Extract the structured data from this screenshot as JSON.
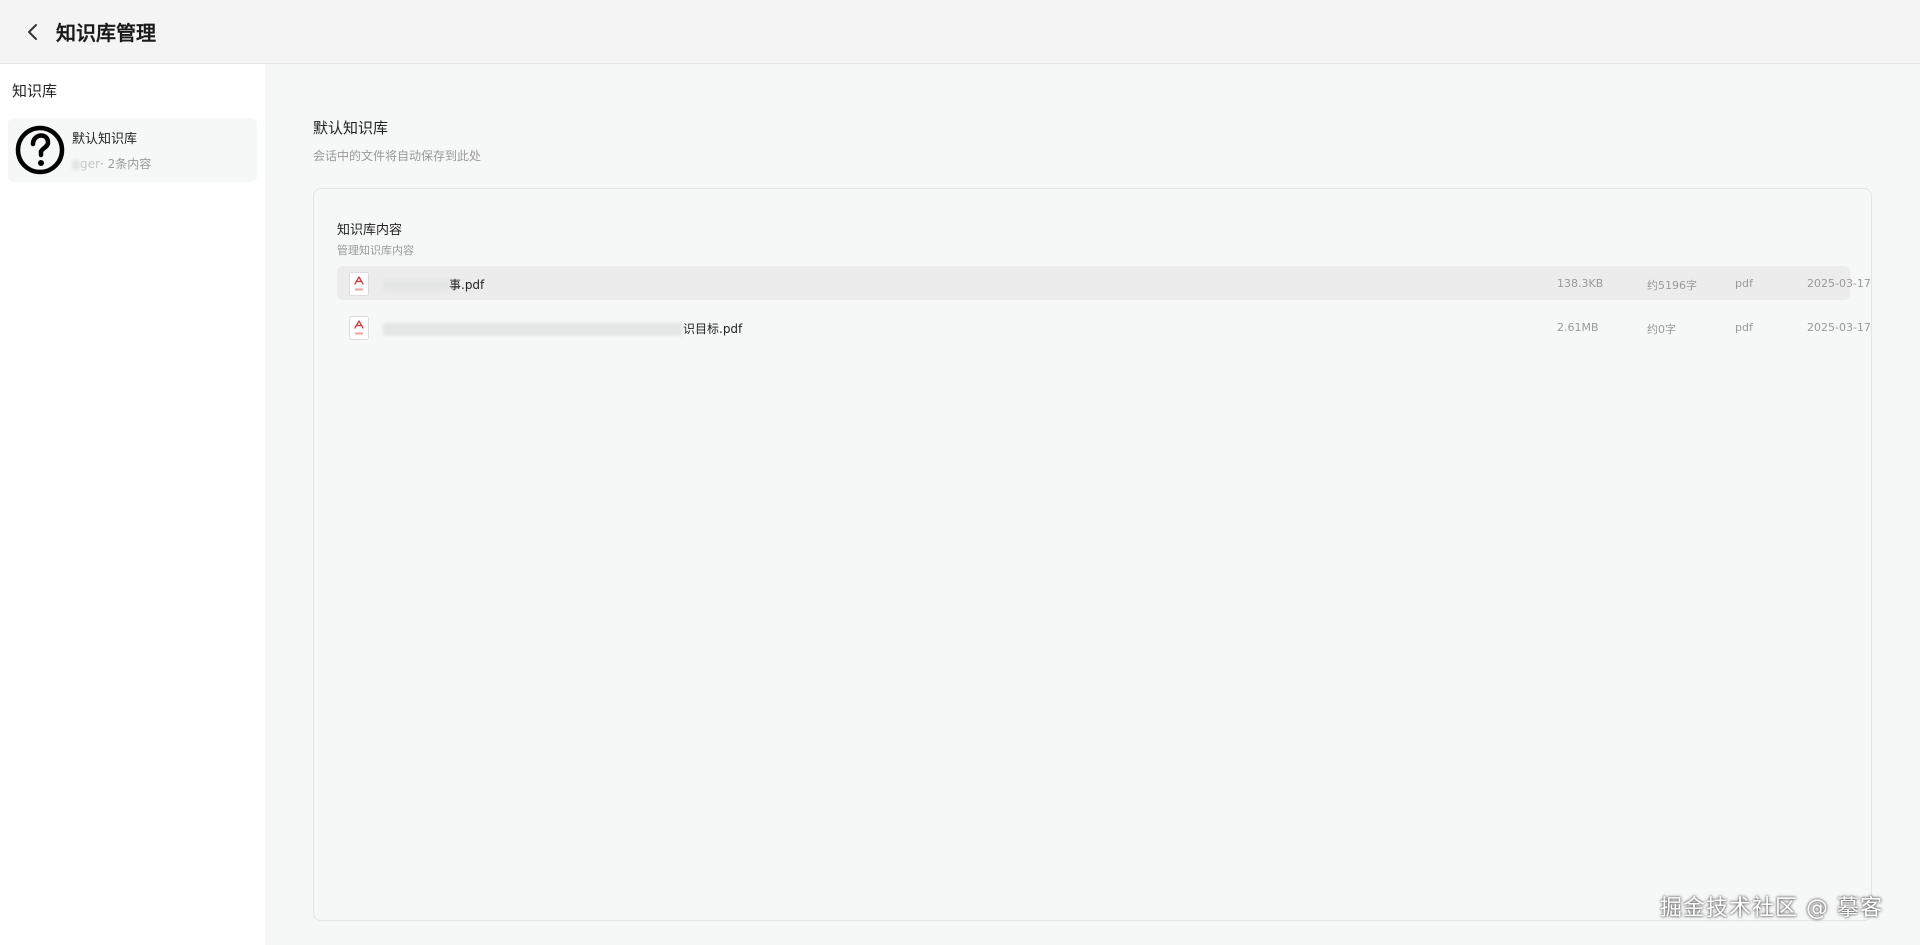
{
  "header": {
    "title": "知识库管理",
    "back_icon": "chevron-left-icon"
  },
  "sidebar": {
    "heading": "知识库",
    "items": [
      {
        "name": "默认知识库",
        "owner": "ger",
        "meta": "· 2条内容",
        "icon": "question-circle-icon"
      }
    ]
  },
  "main": {
    "title": "默认知识库",
    "subtitle": "会话中的文件将自动保存到此处",
    "card": {
      "title": "知识库内容",
      "subtitle": "管理知识库内容",
      "files": [
        {
          "name": "事.pdf",
          "size": "138.3KB",
          "words": "约5196字",
          "type": "pdf",
          "date": "2025-03-17",
          "icon": "pdf-file-icon"
        },
        {
          "name": "识目标.pdf",
          "size": "2.61MB",
          "words": "约0字",
          "type": "pdf",
          "date": "2025-03-17",
          "icon": "pdf-file-icon"
        }
      ]
    }
  },
  "watermark": "掘金技术社区 @ 摹客",
  "colors": {
    "pdf_red": "#d9363e",
    "row_highlight": "#ececec",
    "sidebar_bg": "#ffffff",
    "main_bg": "#f6f7f7"
  }
}
